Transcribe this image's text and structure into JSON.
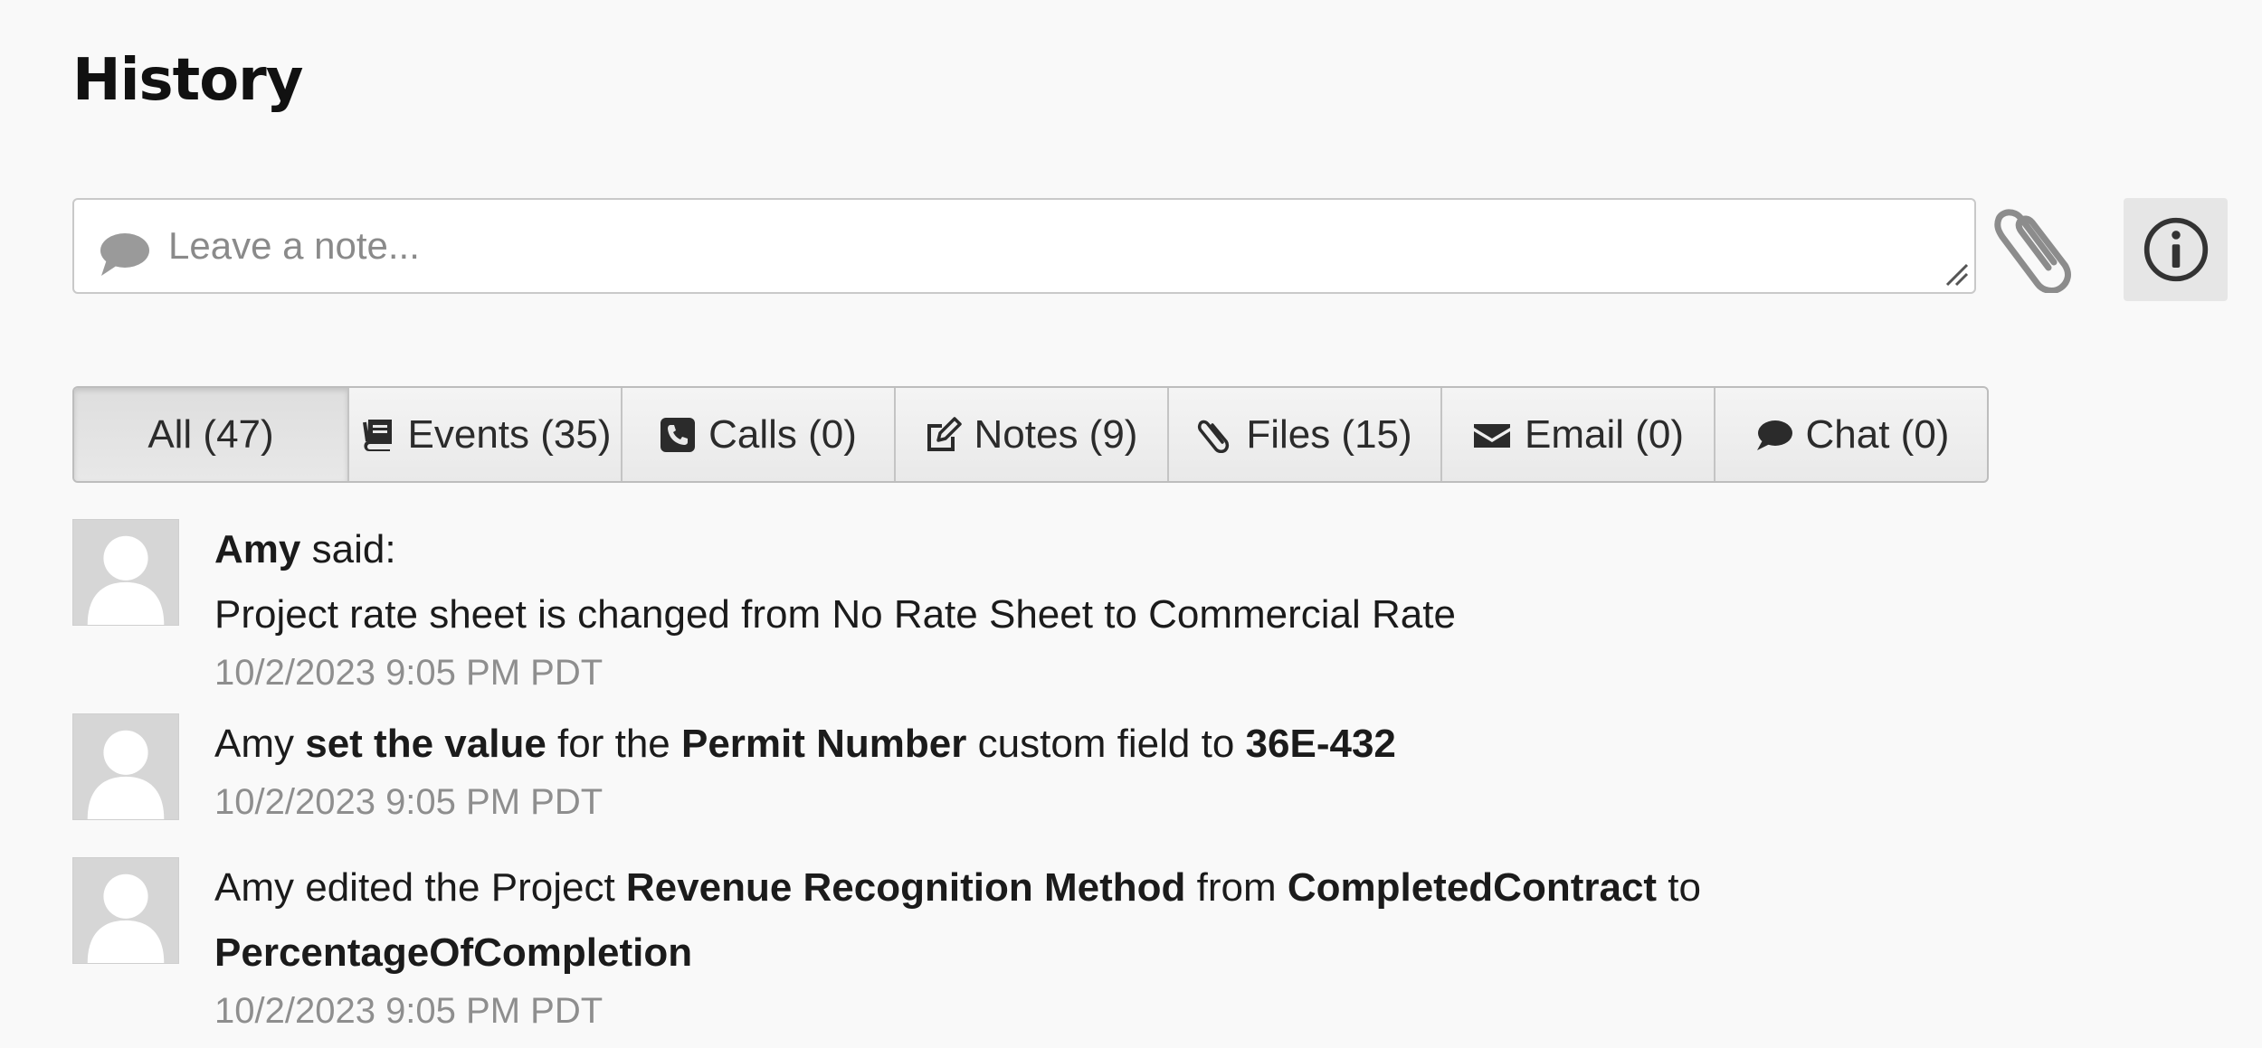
{
  "header": {
    "title": "History"
  },
  "composer": {
    "placeholder": "Leave a note...",
    "bubble_icon": "comment-bubble-icon",
    "attach_icon": "paperclip-icon",
    "info_icon": "info-circle-icon"
  },
  "tabs": [
    {
      "label": "All (47)",
      "icon": "",
      "active": true
    },
    {
      "label": "Events (35)",
      "icon": "book-icon"
    },
    {
      "label": "Calls (0)",
      "icon": "phone-icon"
    },
    {
      "label": "Notes (9)",
      "icon": "edit-note-icon"
    },
    {
      "label": "Files (15)",
      "icon": "paperclip-icon"
    },
    {
      "label": "Email (0)",
      "icon": "envelope-icon"
    },
    {
      "label": "Chat (0)",
      "icon": "chat-bubble-icon"
    }
  ],
  "entries": [
    {
      "author": "Amy",
      "said": " said:",
      "message": "Project rate sheet is changed from No Rate Sheet to Commercial Rate",
      "timestamp": "10/2/2023 9:05 PM PDT"
    },
    {
      "author": "Amy",
      "action": "set the value",
      "for_the": " for the ",
      "field": "Permit Number",
      "custom_field_to": " custom field to ",
      "value": "36E-432",
      "timestamp": "10/2/2023 9:05 PM PDT"
    },
    {
      "prefix": "Amy edited the Project ",
      "field": "Revenue Recognition Method",
      "from": " from ",
      "old_value": "CompletedContract",
      "to": " to",
      "new_value": "PercentageOfCompletion",
      "timestamp": "10/2/2023 9:05 PM PDT"
    }
  ]
}
